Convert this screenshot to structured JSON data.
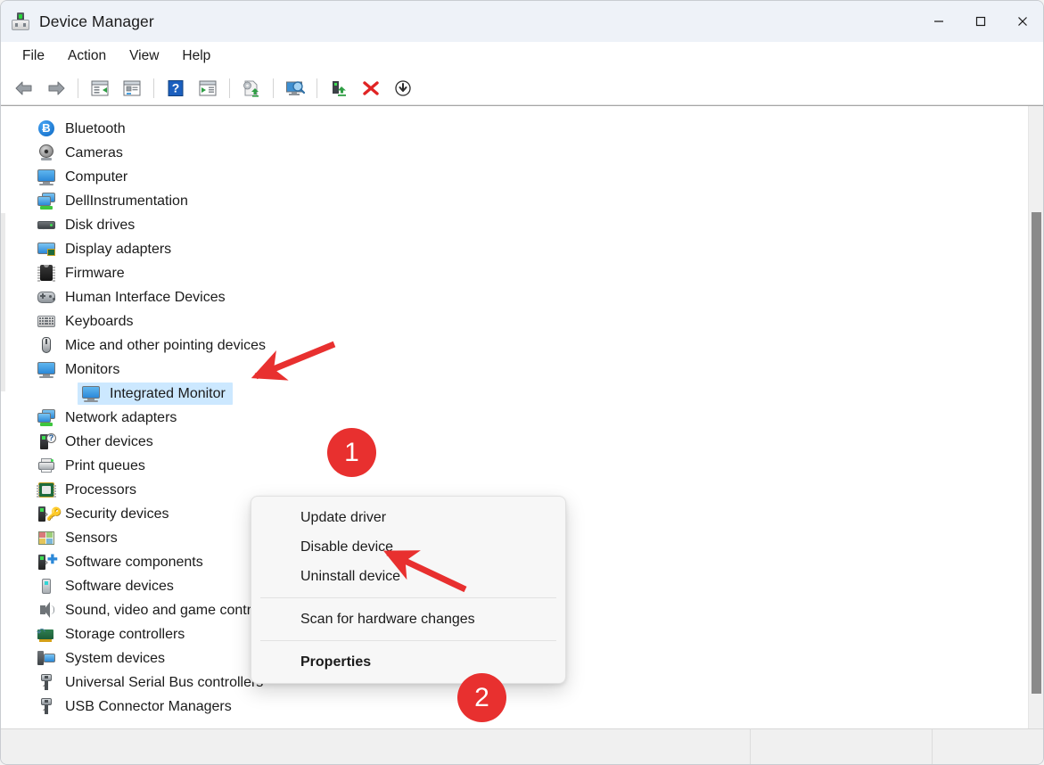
{
  "window": {
    "title": "Device Manager",
    "icon": "device-manager-icon",
    "controls": {
      "minimize": "Minimize",
      "maximize": "Maximize",
      "close": "Close"
    }
  },
  "menubar": {
    "items": [
      {
        "label": "File"
      },
      {
        "label": "Action"
      },
      {
        "label": "View"
      },
      {
        "label": "Help"
      }
    ]
  },
  "toolbar": {
    "buttons": [
      {
        "name": "back-icon",
        "tooltip": "Back"
      },
      {
        "name": "forward-icon",
        "tooltip": "Forward"
      },
      {
        "name": "show-hide-console-tree-icon",
        "tooltip": "Show/Hide Console Tree"
      },
      {
        "name": "properties-icon",
        "tooltip": "Properties"
      },
      {
        "name": "help-icon",
        "tooltip": "Help"
      },
      {
        "name": "show-hide-action-pane-icon",
        "tooltip": "Show/Hide Action Pane"
      },
      {
        "name": "update-driver-icon",
        "tooltip": "Update Driver Software"
      },
      {
        "name": "scan-for-hardware-changes-icon",
        "tooltip": "Scan for hardware changes"
      },
      {
        "name": "enable-device-icon",
        "tooltip": "Enable device"
      },
      {
        "name": "uninstall-device-icon",
        "tooltip": "Uninstall device"
      },
      {
        "name": "disable-device-icon",
        "tooltip": "Disable device"
      }
    ]
  },
  "tree": {
    "items": [
      {
        "label": "Bluetooth",
        "icon": "bluetooth-icon",
        "expander": "collapsed",
        "level": 1
      },
      {
        "label": "Cameras",
        "icon": "camera-icon",
        "expander": "collapsed",
        "level": 1
      },
      {
        "label": "Computer",
        "icon": "computer-icon",
        "expander": "collapsed",
        "level": 1
      },
      {
        "label": "DellInstrumentation",
        "icon": "network-computers-icon",
        "expander": "collapsed",
        "level": 1
      },
      {
        "label": "Disk drives",
        "icon": "disk-drive-icon",
        "expander": "collapsed",
        "level": 1
      },
      {
        "label": "Display adapters",
        "icon": "display-adapter-icon",
        "expander": "collapsed",
        "level": 1
      },
      {
        "label": "Firmware",
        "icon": "firmware-chip-icon",
        "expander": "collapsed",
        "level": 1
      },
      {
        "label": "Human Interface Devices",
        "icon": "hid-gamepad-icon",
        "expander": "collapsed",
        "level": 1
      },
      {
        "label": "Keyboards",
        "icon": "keyboard-icon",
        "expander": "collapsed",
        "level": 1
      },
      {
        "label": "Mice and other pointing devices",
        "icon": "mouse-icon",
        "expander": "collapsed",
        "level": 1
      },
      {
        "label": "Monitors",
        "icon": "monitor-icon",
        "expander": "expanded",
        "level": 1
      },
      {
        "label": "Integrated Monitor",
        "icon": "monitor-icon",
        "expander": "none",
        "level": 2,
        "selected": true
      },
      {
        "label": "Network adapters",
        "icon": "network-computers-icon",
        "expander": "collapsed",
        "level": 1
      },
      {
        "label": "Other devices",
        "icon": "unknown-device-icon",
        "expander": "collapsed",
        "level": 1
      },
      {
        "label": "Print queues",
        "icon": "printer-icon",
        "expander": "collapsed",
        "level": 1
      },
      {
        "label": "Processors",
        "icon": "processor-icon",
        "expander": "collapsed",
        "level": 1
      },
      {
        "label": "Security devices",
        "icon": "security-device-icon",
        "expander": "collapsed",
        "level": 1
      },
      {
        "label": "Sensors",
        "icon": "sensor-icon",
        "expander": "collapsed",
        "level": 1
      },
      {
        "label": "Software components",
        "icon": "software-component-icon",
        "expander": "collapsed",
        "level": 1
      },
      {
        "label": "Software devices",
        "icon": "software-device-icon",
        "expander": "collapsed",
        "level": 1
      },
      {
        "label": "Sound, video and game controllers",
        "icon": "speaker-icon",
        "expander": "collapsed",
        "level": 1
      },
      {
        "label": "Storage controllers",
        "icon": "storage-controller-icon",
        "expander": "collapsed",
        "level": 1
      },
      {
        "label": "System devices",
        "icon": "system-device-icon",
        "expander": "collapsed",
        "level": 1
      },
      {
        "label": "Universal Serial Bus controllers",
        "icon": "usb-icon",
        "expander": "collapsed",
        "level": 1
      },
      {
        "label": "USB Connector Managers",
        "icon": "usb-icon",
        "expander": "collapsed",
        "level": 1
      }
    ]
  },
  "context_menu": {
    "items": [
      {
        "label": "Update driver",
        "bold": false,
        "type": "item"
      },
      {
        "label": "Disable device",
        "bold": false,
        "type": "item"
      },
      {
        "label": "Uninstall device",
        "bold": false,
        "type": "item"
      },
      {
        "type": "separator"
      },
      {
        "label": "Scan for hardware changes",
        "bold": false,
        "type": "item"
      },
      {
        "type": "separator"
      },
      {
        "label": "Properties",
        "bold": true,
        "type": "item"
      }
    ]
  },
  "annotations": [
    {
      "id": "1",
      "label": "1",
      "color": "#e8302f",
      "points_to": "Integrated Monitor"
    },
    {
      "id": "2",
      "label": "2",
      "color": "#e8302f",
      "points_to": "Properties"
    }
  ],
  "statusbar": {
    "pane1": "",
    "pane2": "",
    "pane3": ""
  },
  "colors": {
    "selection": "#cce8ff",
    "annotation_red": "#e8302f",
    "titlebar": "#eef2f8",
    "menu_bg": "#f7f7f7"
  }
}
